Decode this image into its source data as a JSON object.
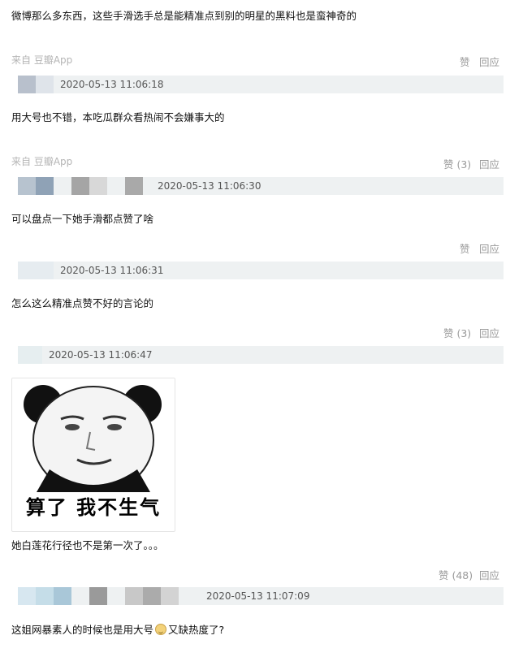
{
  "comments": [
    {
      "text": "微博那么多东西，这些手滑选手总是能精准点到别的明星的黑料也是蛮神奇的",
      "source": "来自  豆瓣App",
      "like": "赞",
      "reply": "回应",
      "timestamp": "2020-05-13 11:06:18"
    },
    {
      "text": "用大号也不错，本吃瓜群众看热闹不会嫌事大的",
      "source": "来自  豆瓣App",
      "like": "赞 (3)",
      "reply": "回应",
      "timestamp": "2020-05-13 11:06:30"
    },
    {
      "text": "可以盘点一下她手滑都点赞了啥",
      "like": "赞",
      "reply": "回应",
      "timestamp": "2020-05-13 11:06:31"
    },
    {
      "text": "怎么这么精准点赞不好的言论的",
      "like": "赞 (3)",
      "reply": "回应",
      "timestamp": "2020-05-13 11:06:47"
    },
    {
      "image_caption": "算了  我不生气",
      "text": "她白莲花行径也不是第一次了。。。",
      "like": "赞 (48)",
      "reply": "回应",
      "timestamp": "2020-05-13 11:07:09"
    },
    {
      "text_before_emoji": "这姐网暴素人的时候也是用大号",
      "text_after_emoji": "又缺热度了?",
      "emoji": "grinning-emoji"
    }
  ],
  "colors": {
    "bar": "#eef1f2",
    "meta": "#b5b5b5",
    "action": "#9a9a9a"
  }
}
